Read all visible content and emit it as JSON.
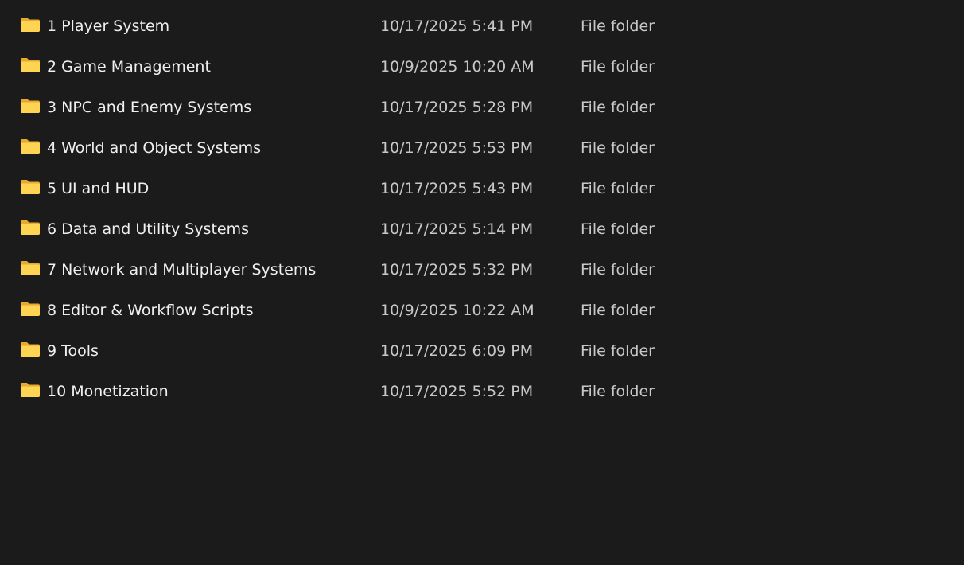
{
  "folders": [
    {
      "name": "1 Player System",
      "date": "10/17/2025 5:41 PM",
      "type": "File folder"
    },
    {
      "name": "2 Game Management",
      "date": "10/9/2025 10:20 AM",
      "type": "File folder"
    },
    {
      "name": "3 NPC and Enemy Systems",
      "date": "10/17/2025 5:28 PM",
      "type": "File folder"
    },
    {
      "name": "4 World and Object Systems",
      "date": "10/17/2025 5:53 PM",
      "type": "File folder"
    },
    {
      "name": "5 UI and HUD",
      "date": "10/17/2025 5:43 PM",
      "type": "File folder"
    },
    {
      "name": "6 Data and Utility Systems",
      "date": "10/17/2025 5:14 PM",
      "type": "File folder"
    },
    {
      "name": "7 Network and Multiplayer Systems",
      "date": "10/17/2025 5:32 PM",
      "type": "File folder"
    },
    {
      "name": "8 Editor & Workflow Scripts",
      "date": "10/9/2025 10:22 AM",
      "type": "File folder"
    },
    {
      "name": "9 Tools",
      "date": "10/17/2025 6:09 PM",
      "type": "File folder"
    },
    {
      "name": "10 Monetization",
      "date": "10/17/2025 5:52 PM",
      "type": "File folder"
    }
  ],
  "icon": "folder-icon",
  "colors": {
    "background": "#1b1b1b",
    "folder_back": "#e7a92f",
    "folder_front": "#ffd452",
    "name_text": "#f0f0f0",
    "meta_text": "#c8c8c8"
  }
}
